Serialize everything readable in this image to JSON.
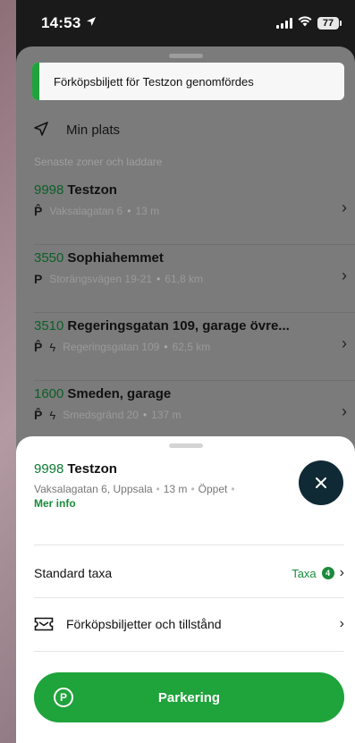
{
  "status": {
    "time": "14:53",
    "battery": "77"
  },
  "toast": {
    "text": "Förköpsbiljett för Testzon genomfördes"
  },
  "my_location": {
    "label": "Min plats"
  },
  "recent": {
    "heading": "Senaste zoner och laddare",
    "zones": [
      {
        "num": "9998",
        "name": "Testzon",
        "address": "Vaksalagatan 6",
        "distance": "13 m",
        "charger": false
      },
      {
        "num": "3550",
        "name": "Sophiahemmet",
        "address": "Storängsvägen 19-21",
        "distance": "61,8 km",
        "charger": false
      },
      {
        "num": "3510",
        "name": "Regeringsgatan 109, garage övre...",
        "address": "Regeringsgatan 109",
        "distance": "62,5 km",
        "charger": true
      },
      {
        "num": "1600",
        "name": "Smeden, garage",
        "address": "Smedsgränd 20",
        "distance": "137 m",
        "charger": true
      }
    ]
  },
  "sheet": {
    "num": "9998",
    "name": "Testzon",
    "address": "Vaksalagatan 6, Uppsala",
    "distance": "13 m",
    "status": "Öppet",
    "more_info": "Mer info",
    "rate_label": "Standard taxa",
    "rate_link": "Taxa",
    "rate_count": "4",
    "tickets_label": "Förköpsbiljetter och tillstånd",
    "park_button": "Parkering"
  },
  "colors": {
    "accent": "#1fa33b",
    "zone_number": "#0c5f28",
    "close_button": "#102a35"
  }
}
